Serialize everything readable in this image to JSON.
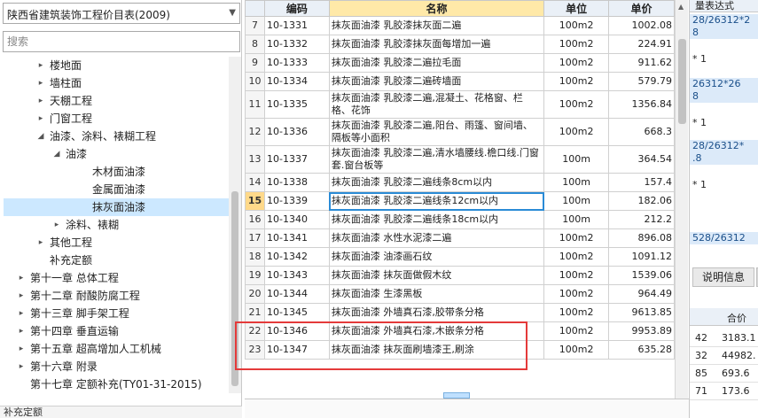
{
  "library_select": {
    "value": "陕西省建筑装饰工程价目表(2009)"
  },
  "search": {
    "placeholder": "搜索"
  },
  "tree": [
    {
      "label": "楼地面",
      "arrow": "▸",
      "indent": 1
    },
    {
      "label": "墙柱面",
      "arrow": "▸",
      "indent": 1
    },
    {
      "label": "天棚工程",
      "arrow": "▸",
      "indent": 1
    },
    {
      "label": "门窗工程",
      "arrow": "▸",
      "indent": 1
    },
    {
      "label": "油漆、涂料、裱糊工程",
      "arrow": "◢",
      "indent": 1
    },
    {
      "label": "油漆",
      "arrow": "◢",
      "indent": 2
    },
    {
      "label": "木材面油漆",
      "arrow": "",
      "indent": 3
    },
    {
      "label": "金属面油漆",
      "arrow": "",
      "indent": 3
    },
    {
      "label": "抹灰面油漆",
      "arrow": "",
      "indent": 3,
      "selected": true
    },
    {
      "label": "涂料、裱糊",
      "arrow": "▸",
      "indent": 2
    },
    {
      "label": "其他工程",
      "arrow": "▸",
      "indent": 1
    },
    {
      "label": "补充定额",
      "arrow": "",
      "indent": 1
    },
    {
      "label": "第十一章 总体工程",
      "arrow": "▸",
      "indent": 0
    },
    {
      "label": "第十二章 耐酸防腐工程",
      "arrow": "▸",
      "indent": 0
    },
    {
      "label": "第十三章 脚手架工程",
      "arrow": "▸",
      "indent": 0
    },
    {
      "label": "第十四章 垂直运输",
      "arrow": "▸",
      "indent": 0
    },
    {
      "label": "第十五章 超高增加人工机械",
      "arrow": "▸",
      "indent": 0
    },
    {
      "label": "第十六章 附录",
      "arrow": "▸",
      "indent": 0
    },
    {
      "label": "第十七章 定额补充(TY01-31-2015)",
      "arrow": "",
      "indent": 0
    }
  ],
  "left_bottom_text": "补充定额",
  "table": {
    "headers": [
      "",
      "编码",
      "名称",
      "单位",
      "单价"
    ],
    "rows": [
      {
        "n": "7",
        "code": "10-1331",
        "name": "抹灰面油漆 乳胶漆抹灰面二遍",
        "unit": "100m2",
        "price": "1002.08"
      },
      {
        "n": "8",
        "code": "10-1332",
        "name": "抹灰面油漆 乳胶漆抹灰面每增加一遍",
        "unit": "100m2",
        "price": "224.91"
      },
      {
        "n": "9",
        "code": "10-1333",
        "name": "抹灰面油漆 乳胶漆二遍拉毛面",
        "unit": "100m2",
        "price": "911.62"
      },
      {
        "n": "10",
        "code": "10-1334",
        "name": "抹灰面油漆 乳胶漆二遍砖墙面",
        "unit": "100m2",
        "price": "579.79"
      },
      {
        "n": "11",
        "code": "10-1335",
        "name": "抹灰面油漆 乳胶漆二遍,混凝土、花格窗、栏格、花饰",
        "unit": "100m2",
        "price": "1356.84"
      },
      {
        "n": "12",
        "code": "10-1336",
        "name": "抹灰面油漆 乳胶漆二遍,阳台、雨篷、窗间墙、隔板等小面积",
        "unit": "100m2",
        "price": "668.3"
      },
      {
        "n": "13",
        "code": "10-1337",
        "name": "抹灰面油漆 乳胶漆二遍,清水墙腰线.檐口线.门窗套.窗台板等",
        "unit": "100m",
        "price": "364.54"
      },
      {
        "n": "14",
        "code": "10-1338",
        "name": "抹灰面油漆 乳胶漆二遍线条8cm以内",
        "unit": "100m",
        "price": "157.4"
      },
      {
        "n": "15",
        "code": "10-1339",
        "name": "抹灰面油漆 乳胶漆二遍线条12cm以内",
        "unit": "100m",
        "price": "182.06",
        "active": true
      },
      {
        "n": "16",
        "code": "10-1340",
        "name": "抹灰面油漆 乳胶漆二遍线条18cm以内",
        "unit": "100m",
        "price": "212.2"
      },
      {
        "n": "17",
        "code": "10-1341",
        "name": "抹灰面油漆 水性水泥漆二遍",
        "unit": "100m2",
        "price": "896.08"
      },
      {
        "n": "18",
        "code": "10-1342",
        "name": "抹灰面油漆 油漆画石纹",
        "unit": "100m2",
        "price": "1091.12"
      },
      {
        "n": "19",
        "code": "10-1343",
        "name": "抹灰面油漆 抹灰面做假木纹",
        "unit": "100m2",
        "price": "1539.06"
      },
      {
        "n": "20",
        "code": "10-1344",
        "name": "抹灰面油漆 生漆黑板",
        "unit": "100m2",
        "price": "964.49"
      },
      {
        "n": "21",
        "code": "10-1345",
        "name": "抹灰面油漆 外墙真石漆,胶带条分格",
        "unit": "100m2",
        "price": "9613.85"
      },
      {
        "n": "22",
        "code": "10-1346",
        "name": "抹灰面油漆 外墙真石漆,木嵌条分格",
        "unit": "100m2",
        "price": "9953.89"
      },
      {
        "n": "23",
        "code": "10-1347",
        "name": "抹灰面油漆 抹灰面刷墙漆王,刷涂",
        "unit": "100m2",
        "price": "635.28"
      }
    ]
  },
  "right_panel": {
    "header": "量表达式",
    "cells": [
      {
        "text": "28/26312*2",
        "blue": true
      },
      {
        "text": "8",
        "blue": true
      },
      {
        "text": "* 1",
        "blue": false
      },
      {
        "text": "26312*26",
        "blue": true
      },
      {
        "text": "8",
        "blue": true
      },
      {
        "text": "* 1",
        "blue": false
      },
      {
        "text": "28/26312*",
        "blue": true
      },
      {
        "text": ".8",
        "blue": true
      },
      {
        "text": "* 1",
        "blue": false
      },
      {
        "text": "528/26312",
        "blue": true
      }
    ],
    "tab_label": "说明信息",
    "col_header": "合价",
    "rows": [
      {
        "a": "42",
        "b": "3183.1"
      },
      {
        "a": "32",
        "b": "44982."
      },
      {
        "a": "85",
        "b": "693.6"
      },
      {
        "a": "71",
        "b": "173.6"
      }
    ]
  }
}
